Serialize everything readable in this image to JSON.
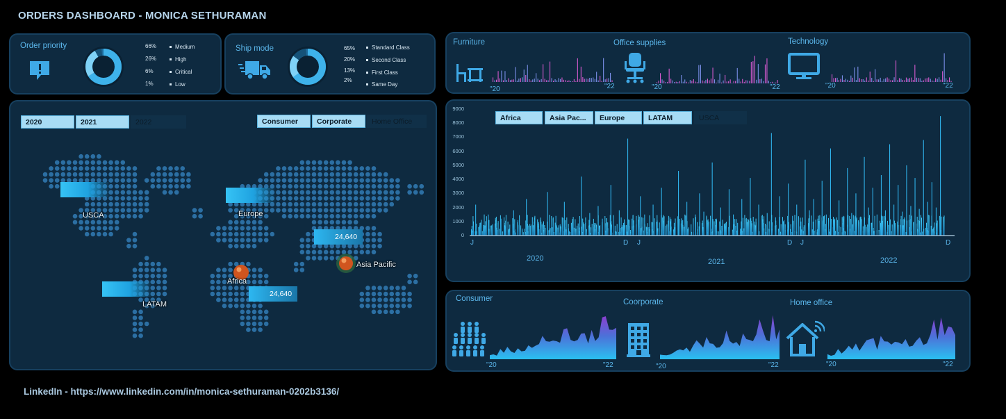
{
  "header": {
    "title": "ORDERS DASHBOARD - MONICA SETHURAMAN"
  },
  "order_priority": {
    "label": "Order priority",
    "icon": "chat-alert-icon",
    "rows": [
      {
        "pct": "66%",
        "name": "Medium",
        "value": 66
      },
      {
        "pct": "26%",
        "name": "High",
        "value": 26
      },
      {
        "pct": "6%",
        "name": "Critical",
        "value": 6
      },
      {
        "pct": "1%",
        "name": "Low",
        "value": 1
      }
    ]
  },
  "ship_mode": {
    "label": "Ship mode",
    "icon": "truck-icon",
    "rows": [
      {
        "pct": "65%",
        "name": "Standard Class",
        "value": 65
      },
      {
        "pct": "20%",
        "name": "Second Class",
        "value": 20
      },
      {
        "pct": "13%",
        "name": "First Class",
        "value": 13
      },
      {
        "pct": "2%",
        "name": "Same Day",
        "value": 2
      }
    ]
  },
  "year_slicer": [
    "2020",
    "2021",
    "2022"
  ],
  "segment_slicer": [
    "Consumer",
    "Corporate",
    "Home Office"
  ],
  "region_slicer": [
    "Africa",
    "Asia Pac...",
    "Europe",
    "LATAM",
    "USCA"
  ],
  "map": {
    "regions": [
      {
        "name": "USCA"
      },
      {
        "name": "Europe"
      },
      {
        "name": "Asia Pacific",
        "value": "24,640"
      },
      {
        "name": "Africa",
        "value": "24,640"
      },
      {
        "name": "LATAM"
      }
    ]
  },
  "categories": [
    {
      "name": "Furniture",
      "icon": "desk-chair-icon",
      "start": "\"20",
      "end": "\"22"
    },
    {
      "name": "Office supplies",
      "icon": "office-chair-icon",
      "start": "\"20",
      "end": "\"22"
    },
    {
      "name": "Technology",
      "icon": "monitor-icon",
      "start": "\"20",
      "end": "\"22"
    }
  ],
  "segments": [
    {
      "name": "Consumer",
      "icon": "people-group-icon",
      "start": "\"20",
      "end": "\"22"
    },
    {
      "name": "Coorporate",
      "icon": "office-building-icon",
      "start": "\"20",
      "end": "\"22"
    },
    {
      "name": "Home office",
      "icon": "smart-home-icon",
      "start": "\"20",
      "end": "\"22"
    }
  ],
  "main_chart": {
    "month_marks": [
      "J",
      "D",
      "J",
      "D",
      "J",
      "D"
    ],
    "years": [
      "2020",
      "2021",
      "2022"
    ]
  },
  "footer": {
    "linkedin": "LinkedIn -  https://www.linkedin.com/in/monica-sethuraman-0202b3136/"
  },
  "colors": {
    "accent": "#36c3f5",
    "panel": "#0e2a40",
    "border": "#17405f",
    "pink": "#e05ad8",
    "purple": "#7a4bd6"
  },
  "chart_data": {
    "type": "bar",
    "title": "",
    "xlabel": "",
    "ylabel": "",
    "ylim": [
      0,
      9000
    ],
    "yticks": [
      "9000",
      "8000",
      "7000",
      "6000",
      "5000",
      "4000",
      "3000",
      "2000",
      "1000",
      "0"
    ],
    "x_range": [
      "2020-01",
      "2022-12"
    ],
    "series": [
      {
        "values": [
          450,
          2200,
          900,
          600,
          1500,
          800,
          400,
          1200,
          650,
          300,
          1800,
          1100,
          500,
          2600,
          700,
          1300,
          450,
          900,
          3100,
          600,
          1400,
          800,
          2400,
          520,
          1000,
          700,
          4200,
          900,
          1600,
          600,
          2100,
          1200,
          500,
          3600,
          700,
          1800,
          900,
          6900,
          1200,
          800,
          2800,
          1500,
          600,
          2200,
          1000,
          3400,
          700,
          1300,
          900,
          4600,
          1100,
          2400,
          800,
          1500,
          3000,
          1700,
          900,
          5200,
          1200,
          2000,
          800,
          3300,
          1500,
          900,
          2600,
          1200,
          4100,
          1000,
          2200,
          900,
          1600,
          7300,
          1300,
          2800,
          1100,
          3700,
          1400,
          2200,
          1000,
          5400,
          1800,
          2600,
          1200,
          3900,
          1500,
          6200,
          1200,
          2500,
          1400,
          4800,
          1600,
          3000,
          1300,
          5600,
          2000,
          3400,
          1500,
          4300,
          1800,
          6500,
          2200,
          3600,
          1700,
          5000,
          2100,
          4100,
          1900,
          6800,
          2400,
          3800,
          2000,
          8500
        ]
      }
    ]
  }
}
